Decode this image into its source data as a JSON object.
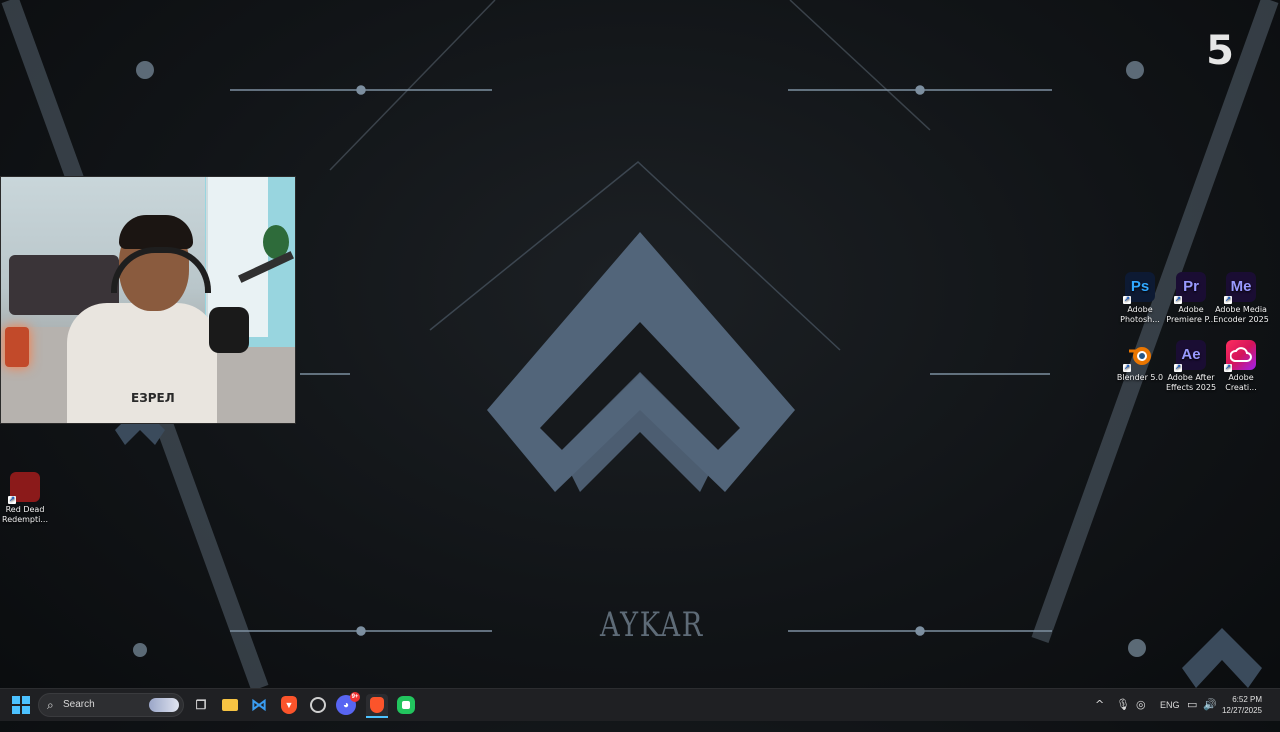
{
  "wallpaper": {
    "brand_text": "AYKAR",
    "corner_number": "5",
    "accent_color": "#6d8aa6"
  },
  "webcam": {
    "shirt_text": "ЕЗРЕЛ"
  },
  "desktop_icons": [
    {
      "name": "red-dead-redemption",
      "label_line1": "Red Dead",
      "label_line2": "Redempti...",
      "icon": "rdr-icon",
      "glyph": "",
      "color": "#8b1a1a"
    },
    {
      "name": "adobe-photoshop",
      "label_line1": "Adobe",
      "label_line2": "Photosh...",
      "icon": "photoshop-icon",
      "glyph": "Ps",
      "color": "#0d1a33"
    },
    {
      "name": "adobe-premiere",
      "label_line1": "Adobe",
      "label_line2": "Premiere P...",
      "icon": "premiere-icon",
      "glyph": "Pr",
      "color": "#1a0d33"
    },
    {
      "name": "adobe-media-encoder",
      "label_line1": "Adobe Media",
      "label_line2": "Encoder 2025",
      "icon": "media-encoder-icon",
      "glyph": "Me",
      "color": "#1a0d33"
    },
    {
      "name": "blender",
      "label_line1": "Blender 5.0",
      "label_line2": "",
      "icon": "blender-icon",
      "glyph": "",
      "color": "transparent"
    },
    {
      "name": "adobe-after-effects",
      "label_line1": "Adobe After",
      "label_line2": "Effects 2025",
      "icon": "after-effects-icon",
      "glyph": "Ae",
      "color": "#1a0d33"
    },
    {
      "name": "adobe-creative-cloud",
      "label_line1": "Adobe",
      "label_line2": "Creati...",
      "icon": "creative-cloud-icon",
      "glyph": "",
      "color": "#d4145a"
    }
  ],
  "taskbar": {
    "search_label": "Search",
    "apps": [
      {
        "name": "task-view",
        "icon": "task-view-icon"
      },
      {
        "name": "file-explorer",
        "icon": "folder-icon"
      },
      {
        "name": "vs-code",
        "icon": "vscode-icon"
      },
      {
        "name": "brave-browser",
        "icon": "brave-icon"
      },
      {
        "name": "chrome-app",
        "icon": "chrome-icon"
      },
      {
        "name": "discord",
        "icon": "discord-icon",
        "badge": "9+"
      },
      {
        "name": "brave-alt",
        "icon": "brave-icon"
      },
      {
        "name": "app-green",
        "icon": "app-icon"
      }
    ],
    "tray": {
      "language": "ENG",
      "time": "6:52 PM",
      "date": "12/27/2025"
    }
  }
}
